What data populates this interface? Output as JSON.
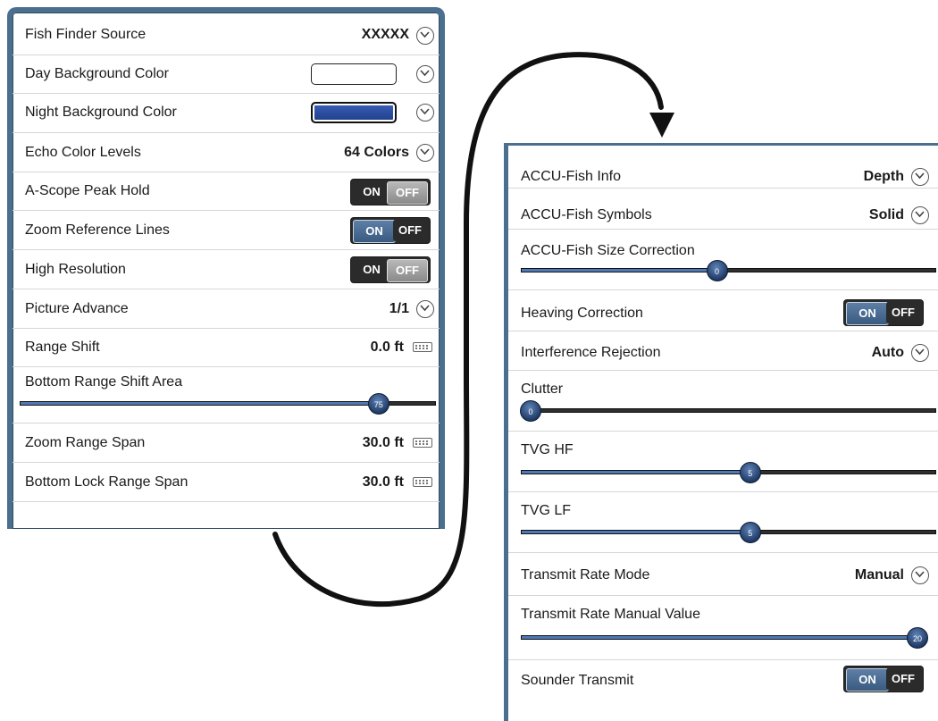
{
  "left_panel": {
    "fish_finder_source": {
      "label": "Fish Finder Source",
      "value": "XXXXX"
    },
    "day_background_color": {
      "label": "Day Background Color"
    },
    "night_background_color": {
      "label": "Night Background Color"
    },
    "echo_color_levels": {
      "label": "Echo Color Levels",
      "value": "64 Colors"
    },
    "a_scope_peak_hold": {
      "label": "A-Scope Peak Hold",
      "on": "ON",
      "off": "OFF",
      "state": "off"
    },
    "zoom_reference_lines": {
      "label": "Zoom Reference Lines",
      "on": "ON",
      "off": "OFF",
      "state": "on"
    },
    "high_resolution": {
      "label": "High Resolution",
      "on": "ON",
      "off": "OFF",
      "state": "off"
    },
    "picture_advance": {
      "label": "Picture Advance",
      "value": "1/1"
    },
    "range_shift": {
      "label": "Range Shift",
      "value": "0.0 ft"
    },
    "bottom_range_shift_area": {
      "label": "Bottom Range Shift Area",
      "value": "75",
      "fraction": 0.86
    },
    "zoom_range_span": {
      "label": "Zoom Range Span",
      "value": "30.0 ft"
    },
    "bottom_lock_range_span": {
      "label": "Bottom Lock Range Span",
      "value": "30.0 ft"
    }
  },
  "right_panel": {
    "accu_fish_info": {
      "label": "ACCU-Fish Info",
      "value": "Depth"
    },
    "accu_fish_symbols": {
      "label": "ACCU-Fish Symbols",
      "value": "Solid"
    },
    "accu_fish_size_correction": {
      "label": "ACCU-Fish Size Correction",
      "value": "0",
      "fraction": 0.47
    },
    "heaving_correction": {
      "label": "Heaving Correction",
      "on": "ON",
      "off": "OFF",
      "state": "on"
    },
    "interference_rejection": {
      "label": "Interference Rejection",
      "value": "Auto"
    },
    "clutter": {
      "label": "Clutter",
      "value": "0",
      "fraction": 0.0
    },
    "tvg_hf": {
      "label": "TVG HF",
      "value": "5",
      "fraction": 0.55
    },
    "tvg_lf": {
      "label": "TVG LF",
      "value": "5",
      "fraction": 0.55
    },
    "transmit_rate_mode": {
      "label": "Transmit Rate Mode",
      "value": "Manual"
    },
    "transmit_rate_manual_value": {
      "label": "Transmit Rate Manual Value",
      "value": "20",
      "fraction": 1.0
    },
    "sounder_transmit": {
      "label": "Sounder Transmit",
      "on": "ON",
      "off": "OFF",
      "state": "on"
    }
  },
  "colors": {
    "accent": "#4f79b6",
    "night_color": "#2f4fa3",
    "toggle_on": "#3a5a80",
    "panel_border": "#4a6f8f"
  }
}
